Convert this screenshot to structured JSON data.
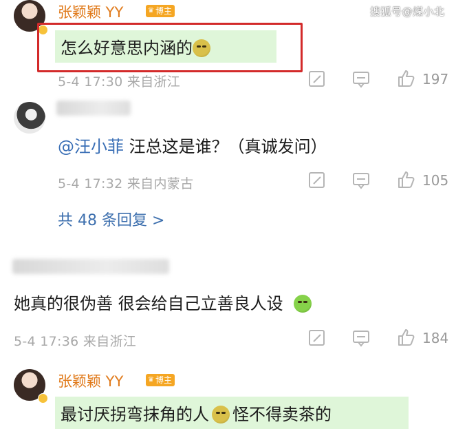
{
  "watermark": "搜狐号@煤小北",
  "comments": [
    {
      "username": "张颖颖 YY",
      "badge": "博主",
      "text": "怎么好意思内涵的",
      "emoji": "dizzy-face-emoji",
      "time": "5-4 17:30",
      "location": "来自浙江",
      "likes": "197"
    },
    {
      "mention": "@汪小菲",
      "text": "汪总这是谁？（真诚发问）",
      "time": "5-4 17:32",
      "location": "来自内蒙古",
      "likes": "105",
      "replies_link": "共 48 条回复 >"
    },
    {
      "text": "她真的很伪善 很会给自己立善良人设",
      "emoji": "vomiting-face-emoji",
      "time": "5-4 17:36",
      "location": "来自浙江",
      "likes": "184"
    },
    {
      "username": "张颖颖 YY",
      "badge": "博主",
      "text_before": "最讨厌拐弯抹角的人",
      "emoji": "dizzy-face-emoji",
      "text_after": "怪不得卖茶的"
    }
  ],
  "colors": {
    "username": "#e07a1b",
    "mention": "#3a6fb6",
    "highlight": "#dff6d9",
    "red_box": "#d32a2a"
  }
}
